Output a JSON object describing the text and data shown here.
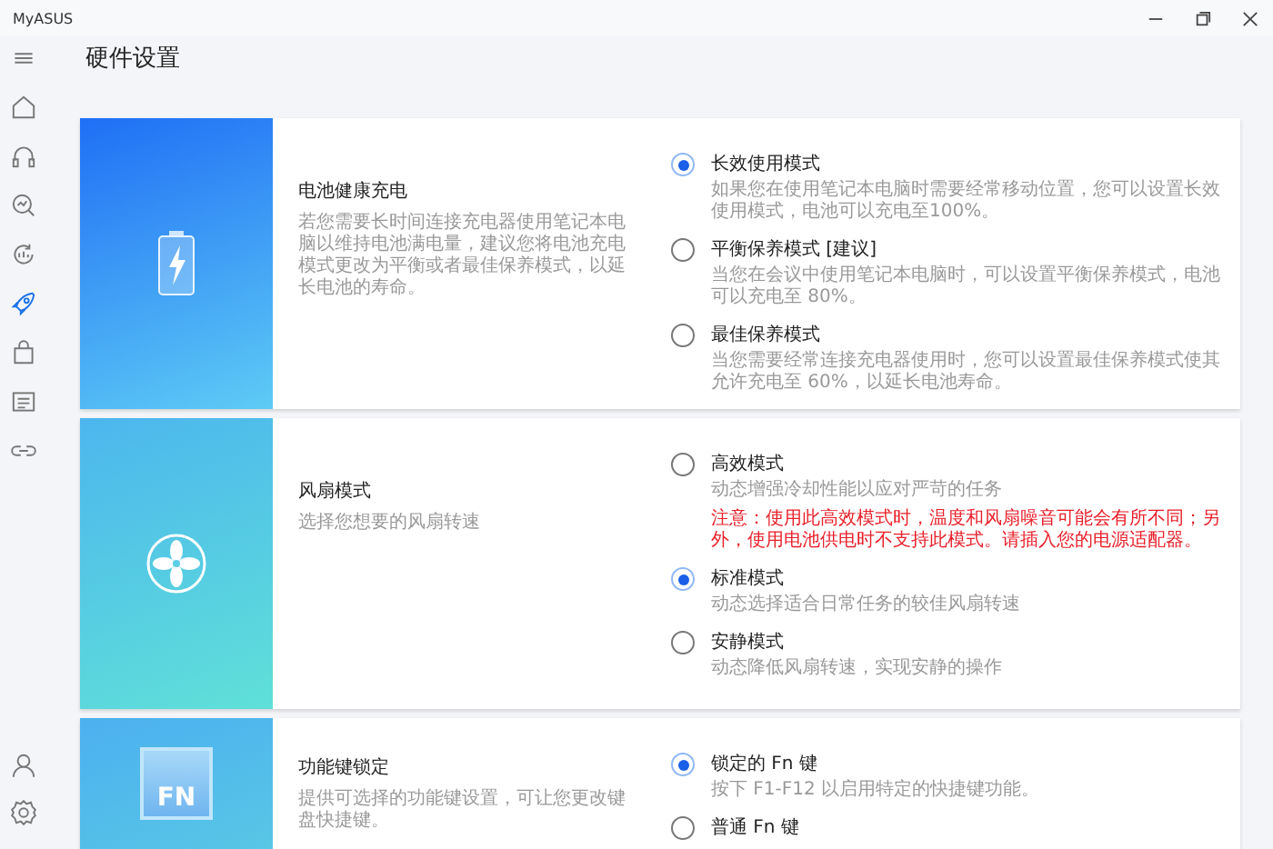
{
  "window": {
    "title": "MyASUS"
  },
  "sidebar": {
    "items": [
      {
        "kind": "home",
        "selected": false
      },
      {
        "kind": "headset",
        "selected": false
      },
      {
        "kind": "diagnosis",
        "selected": false
      },
      {
        "kind": "recovery",
        "selected": false
      },
      {
        "kind": "rocket",
        "selected": true
      },
      {
        "kind": "bag",
        "selected": false
      },
      {
        "kind": "news",
        "selected": false
      },
      {
        "kind": "link",
        "selected": false
      }
    ],
    "bottom_items": [
      {
        "kind": "user",
        "selected": false
      },
      {
        "kind": "settings",
        "selected": false
      }
    ]
  },
  "page": {
    "title": "硬件设置"
  },
  "cards": [
    {
      "kind": "battery",
      "title": "电池健康充电",
      "description": "若您需要长时间连接充电器使用笔记本电脑以维持电池满电量，建议您将电池充电模式更改为平衡或者最佳保养模式，以延长电池的寿命。",
      "options": [
        {
          "label": "长效使用模式",
          "description": "如果您在使用笔记本电脑时需要经常移动位置，您可以设置长效使用模式，电池可以充电至100%。",
          "selected": true
        },
        {
          "label": "平衡保养模式 [建议]",
          "description": "当您在会议中使用笔记本电脑时，可以设置平衡保养模式，电池可以充电至 80%。",
          "selected": false
        },
        {
          "label": "最佳保养模式",
          "description": "当您需要经常连接充电器使用时，您可以设置最佳保养模式使其允许充电至 60%，以延长电池寿命。",
          "selected": false
        }
      ]
    },
    {
      "kind": "fan",
      "title": "风扇模式",
      "description": "选择您想要的风扇转速",
      "options": [
        {
          "label": "高效模式",
          "description": "动态增强冷却性能以应对严苛的任务",
          "warning": "注意：使用此高效模式时，温度和风扇噪音可能会有所不同；另外，使用电池供电时不支持此模式。请插入您的电源适配器。",
          "selected": false
        },
        {
          "label": "标准模式",
          "description": "动态选择适合日常任务的较佳风扇转速",
          "selected": true
        },
        {
          "label": "安静模式",
          "description": "动态降低风扇转速，实现安静的操作",
          "selected": false
        }
      ]
    },
    {
      "kind": "fn",
      "icon_text": "FN",
      "title": "功能键锁定",
      "description": "提供可选择的功能键设置，可让您更改键盘快捷键。",
      "options": [
        {
          "label": "锁定的 Fn 键",
          "description": "按下 F1-F12 以启用特定的快捷键功能。",
          "selected": true
        },
        {
          "label": "普通 Fn 键",
          "selected": false
        }
      ]
    }
  ]
}
